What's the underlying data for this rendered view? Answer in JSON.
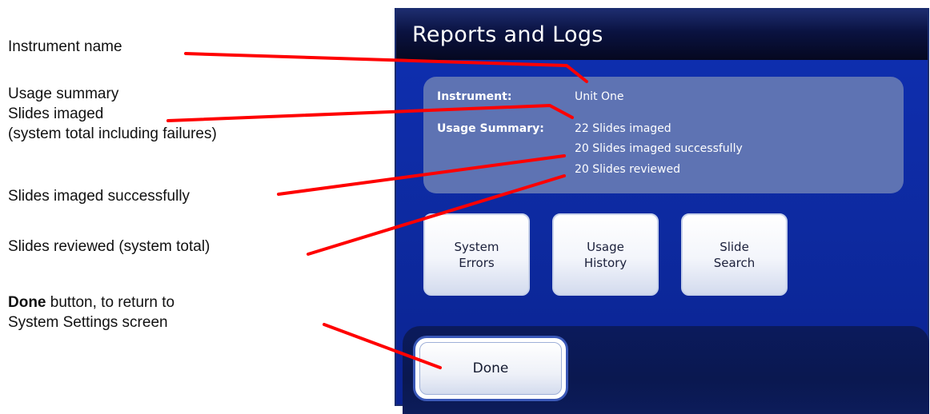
{
  "callouts": {
    "instrument_name": "Instrument name",
    "usage_summary_line1": "Usage summary",
    "usage_summary_line2": "Slides imaged",
    "usage_summary_line3": "(system total including failures)",
    "imaged_successfully": "Slides imaged successfully",
    "reviewed": "Slides reviewed (system total)",
    "done_bold": "Done",
    "done_rest": " button, to return to",
    "done_line2": "System Settings screen"
  },
  "screen": {
    "title": "Reports and Logs",
    "instrument_label": "Instrument:",
    "instrument_value": "Unit One",
    "usage_label": "Usage Summary:",
    "usage_lines": [
      "22 Slides imaged",
      "20 Slides imaged successfully",
      "20 Slides reviewed"
    ],
    "buttons": [
      {
        "line1": "System",
        "line2": "Errors"
      },
      {
        "line1": "Usage",
        "line2": "History"
      },
      {
        "line1": "Slide",
        "line2": "Search"
      }
    ],
    "done_label": "Done"
  },
  "colors": {
    "screen_background": "#0f2fb2",
    "info_panel": "#5e73b3",
    "leader_line": "#ff0000"
  }
}
